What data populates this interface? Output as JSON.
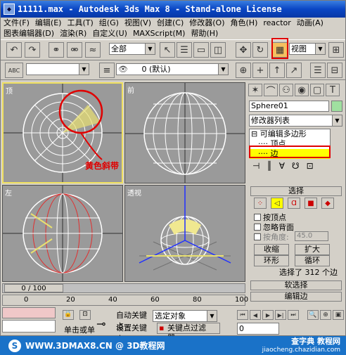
{
  "window": {
    "title": "11111.max - Autodesk 3ds Max 8 - Stand-alone License",
    "icon": "3ds-max-icon"
  },
  "menu": {
    "row1": [
      "文件(F)",
      "编辑(E)",
      "工具(T)",
      "组(G)",
      "视图(V)",
      "创建(C)",
      "修改器(O)",
      "角色(H)",
      "reactor",
      "动画(A)"
    ],
    "row2": [
      "图表编辑器(D)",
      "渲染(R)",
      "自定义(U)",
      "MAXScript(M)",
      "帮助(H)"
    ]
  },
  "toolbar": {
    "selection_filter": "全部",
    "ref_coord": "视图",
    "layer_value": "0 (默认)"
  },
  "viewports": {
    "top_label": "顶",
    "front_label": "前",
    "left_label": "左",
    "persp_label": "透视",
    "annotation": "黄色斜带"
  },
  "command_panel": {
    "object_name": "Sphere01",
    "modifier_list": "修改器列表",
    "stack": {
      "root": "可编辑多边形",
      "sub1": "顶点",
      "sub2": "边"
    },
    "selection_rollout": {
      "title": "选择",
      "by_vertex": "按顶点",
      "ignore_backfacing": "忽略背面",
      "by_angle": "按角度:",
      "angle_value": "45.0",
      "shrink": "收缩",
      "grow": "扩大",
      "ring": "环形",
      "loop": "循环",
      "status": "选择了 312 个边"
    },
    "soft_selection_title": "软选择",
    "edit_edges_title": "编辑边"
  },
  "timeline": {
    "frame_display": "0 / 100",
    "ticks": [
      "0",
      "20",
      "40",
      "60",
      "80",
      "100"
    ]
  },
  "status": {
    "auto_key": "自动关键点",
    "set_key": "设置关键点",
    "selected_object": "选定对象",
    "key_filters": "关键点过滤器...",
    "single_click": "单击或单",
    "frame_value": "0"
  },
  "footer": {
    "left_text": "WWW.3DMAX8.CN @ 3D教程网",
    "right_text": "查字典 教程网",
    "right_url": "jiaocheng.chazidian.com"
  },
  "colors": {
    "title_bar": "#0a46c4",
    "highlight": "#e00000",
    "active_viewport": "#f0e060",
    "footer_bg": "#1a72c8"
  }
}
